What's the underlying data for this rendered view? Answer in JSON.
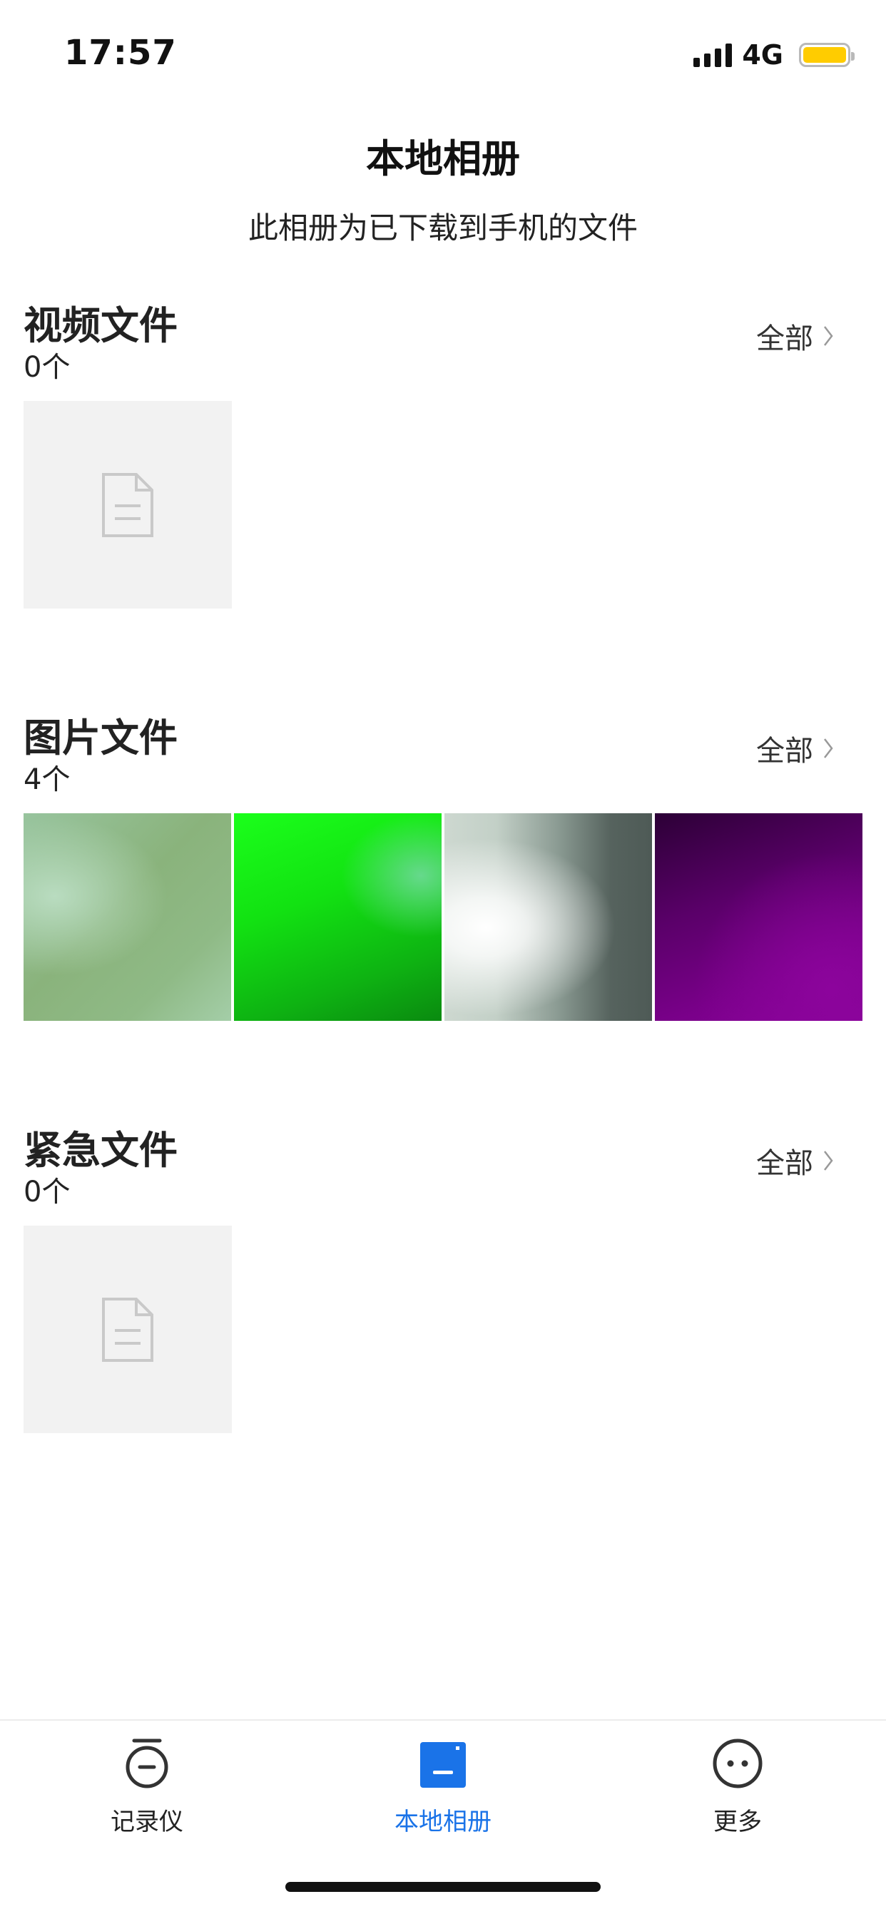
{
  "status_bar": {
    "time": "17:57",
    "network": "4G",
    "battery_color": "#ffcc00"
  },
  "header": {
    "title": "本地相册",
    "subtitle": "此相册为已下载到手机的文件"
  },
  "sections": {
    "video": {
      "title": "视频文件",
      "count": "0个",
      "all_label": "全部",
      "placeholder_icon": "document-icon"
    },
    "images": {
      "title": "图片文件",
      "count": "4个",
      "all_label": "全部",
      "photo_tones": [
        "#8ab37c",
        "#12e212",
        "#8a9a92",
        "#5a0069"
      ]
    },
    "emergency": {
      "title": "紧急文件",
      "count": "0个",
      "all_label": "全部",
      "placeholder_icon": "document-icon"
    }
  },
  "tab_bar": {
    "accent_color": "#1a73e8",
    "tabs": [
      {
        "label": "记录仪",
        "icon": "dashcam-icon",
        "active": false
      },
      {
        "label": "本地相册",
        "icon": "album-icon",
        "active": true
      },
      {
        "label": "更多",
        "icon": "more-icon",
        "active": false
      }
    ]
  }
}
